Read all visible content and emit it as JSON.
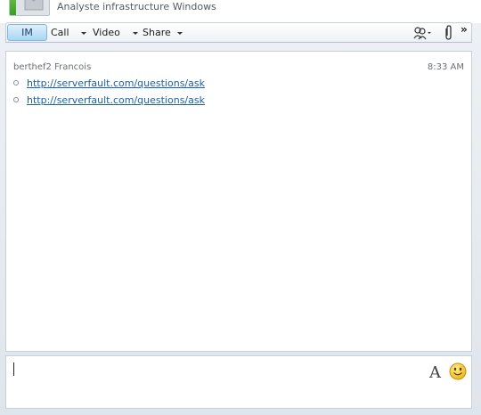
{
  "header": {
    "group_name": "Analyste infrastructure Windows"
  },
  "toolbar": {
    "im_label": "IM",
    "call_label": "Call",
    "video_label": "Video",
    "share_label": "Share",
    "more_label": "»"
  },
  "conversation": {
    "sender": "berthef2 Francois",
    "timestamp": "8:33 AM",
    "messages": [
      {
        "text": "http://serverfault.com/questions/ask"
      },
      {
        "text": "http://serverfault.com/questions/ask"
      }
    ]
  },
  "input": {
    "font_button_label": "A"
  },
  "colors": {
    "link": "#1c61a8",
    "presence_available": "#3c9c22",
    "active_tab": "#a9d6f4"
  }
}
